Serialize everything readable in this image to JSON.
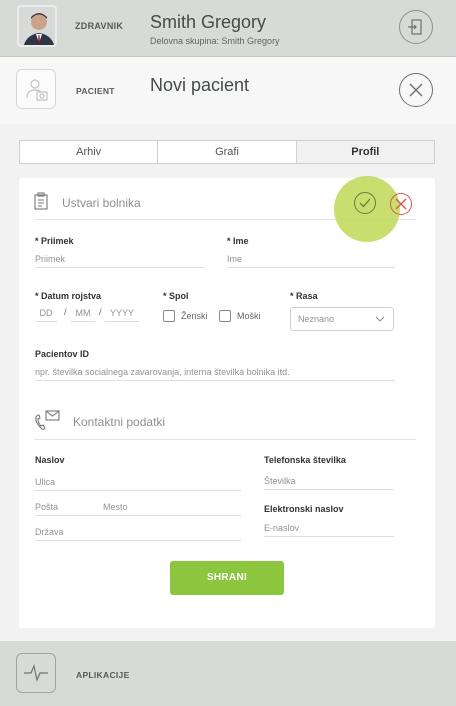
{
  "header": {
    "role_label": "ZDRAVNIK",
    "name": "Smith Gregory",
    "workgroup": "Delovna skupina: Smith Gregory"
  },
  "patient_bar": {
    "role_label": "PACIENT",
    "title": "Novi pacient"
  },
  "tabs": [
    {
      "label": "Arhiv"
    },
    {
      "label": "Grafi"
    },
    {
      "label": "Profil",
      "active": true
    }
  ],
  "form": {
    "section_hospital": "Ustvari bolnika",
    "surname": {
      "label": "* Priimek",
      "placeholder": "Priimek"
    },
    "name": {
      "label": "* Ime",
      "placeholder": "Ime"
    },
    "dob": {
      "label": "* Datum rojstva",
      "dd": "DD",
      "mm": "MM",
      "yyyy": "YYYY",
      "sep": "/"
    },
    "sex": {
      "label": "* Spol",
      "female": "Ženski",
      "male": "Moški"
    },
    "race": {
      "label": "* Rasa",
      "selected": "Neznano"
    },
    "patient_id": {
      "label": "Pacientov ID",
      "placeholder": "npr. številka socialnega zavarovanja, interna številka bolnika itd."
    },
    "section_contact": "Kontaktni podatki",
    "address": {
      "label": "Naslov",
      "street": "Ulica",
      "post": "Pošta",
      "city": "Mesto",
      "country": "Država"
    },
    "phone": {
      "label": "Telefonska številka",
      "placeholder": "Številka"
    },
    "email": {
      "label": "Elektronski naslov",
      "placeholder": "E-naslov"
    },
    "save": "SHRANI"
  },
  "footer": {
    "apps_label": "APLIKACIJE"
  },
  "colors": {
    "accent": "#8cc63f",
    "header_bg": "#d7dbd8",
    "cancel": "#d9534f"
  }
}
